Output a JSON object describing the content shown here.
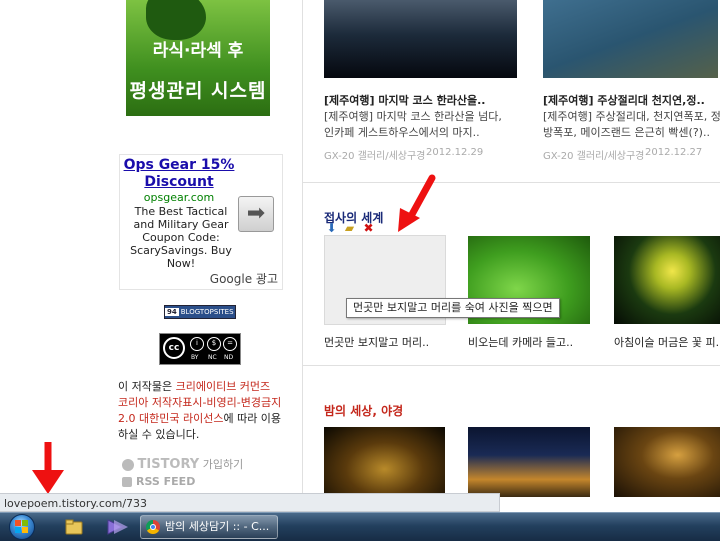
{
  "left": {
    "banner": {
      "line1": "라식·라섹 후",
      "line2": "평생관리 시스템"
    },
    "ad": {
      "title": "Ops Gear 15% Discount",
      "url": "opsgear.com",
      "description": "The Best Tactical and Military Gear Coupon Code: ScarySavings. Buy Now!",
      "arrow": "➡",
      "attribution": "Google 광고"
    },
    "blogtop": {
      "count": "94",
      "label": "BLOGTOPSITES"
    },
    "cc": {
      "logo": "cc",
      "by": "BY",
      "nc": "NC",
      "nd": "ND"
    },
    "license": {
      "pre": "이 저작물은 ",
      "link": "크리에이티브 커먼즈 코리아 저작자표시-비영리-변경금지 2.0 대한민국 라이선스",
      "post": "에 따라 이용하실 수 있습니다."
    },
    "tistory": {
      "brand": "TISTORY",
      "join": "가입하기"
    },
    "rss": "RSS FEED"
  },
  "posts_top": [
    {
      "title": "[제주여행] 마지막 코스 한라산을..",
      "desc1": "[제주여행] 마지막 코스 한라산을 넘다,",
      "desc2": "인카페 게스트하우스에서의 마지..",
      "source": "GX-20 갤러리/세상구경",
      "date": "2012.12.29"
    },
    {
      "title": "[제주여행] 주상절리대 천지연,정..",
      "desc1": "[제주여행] 주상절리대, 천지연폭포, 정",
      "desc2": "방폭포, 메이즈랜드 은근히 빡센(?)..",
      "source": "GX-20 갤러리/세상구경",
      "date": "2012.12.27"
    }
  ],
  "section1": {
    "title": "접사의 세계",
    "tooltip": "먼곳만 보지말고 머리를 숙여 사진을 찍으면",
    "captions": [
      "먼곳만 보지말고 머리..",
      "비오는데 카메라 들고..",
      "아침이슬 머금은 꽃 피.."
    ]
  },
  "section2": {
    "title": "밤의 세상, 야경"
  },
  "status_url": "lovepoem.tistory.com/733",
  "taskbar": {
    "chrome_label": "밤의 세상담기 :: - C..."
  },
  "colors": {
    "accent_red": "#c4281c",
    "navy": "#1a2a78",
    "taskbar": "#23405e"
  }
}
